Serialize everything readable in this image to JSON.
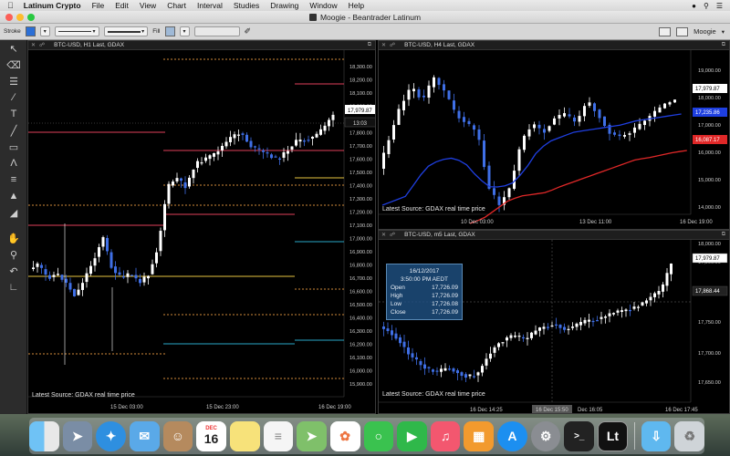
{
  "menubar": {
    "app": "Latinum Crypto",
    "items": [
      "File",
      "Edit",
      "View",
      "Chart",
      "Interval",
      "Studies",
      "Drawing",
      "Window",
      "Help"
    ]
  },
  "window": {
    "title": "Moogie - Beantrader Latinum"
  },
  "toolbar": {
    "stroke_label": "Stroke",
    "fill_label": "Fill",
    "profile": "Moogie"
  },
  "colors": {
    "candle_up": "#ffffff",
    "candle_down": "#3f6fe6",
    "level_red": "#e0405a",
    "level_orange": "#d08a3a",
    "level_yellow": "#e6c341",
    "level_cyan": "#2aa7c9",
    "ma_blue": "#1f3fe0",
    "ma_red": "#e02828"
  },
  "panes": [
    {
      "id": "h1",
      "title": "BTC-USD, H1 Last, GDAX",
      "source": "Latest Source: GDAX real time price",
      "axis_labels": [
        "18,300.00",
        "18,200.00",
        "18,100.00",
        "18,000.00",
        "17,900.00",
        "17,800.00",
        "17,700.00",
        "17,600.00",
        "17,500.00",
        "17,400.00",
        "17,300.00",
        "17,200.00",
        "17,100.00",
        "17,000.00",
        "16,900.00",
        "16,800.00",
        "16,700.00",
        "16,600.00",
        "16,500.00",
        "16,400.00",
        "16,300.00",
        "16,200.00",
        "16,100.00",
        "16,000.00",
        "15,900.00"
      ],
      "time_labels": [
        "15 Dec 03:00",
        "15 Dec 23:00",
        "16 Dec 19:00"
      ],
      "price_tag": "17,979.87",
      "countdown": "13:03"
    },
    {
      "id": "h4",
      "title": "BTC-USD, H4 Last, GDAX",
      "source": "Latest Source: GDAX real time price",
      "axis_labels": [
        "19,000.00",
        "18,000.00",
        "17,000.00",
        "16,000.00",
        "15,000.00",
        "14,000.00"
      ],
      "time_labels": [
        "10 Dec 03:00",
        "13 Dec 11:00",
        "16 Dec 19:00"
      ],
      "price_tags": [
        "17,979.87",
        "17,235.86",
        "16,087.17"
      ]
    },
    {
      "id": "m5",
      "title": "BTC-USD, m5 Last, GDAX",
      "source": "Latest Source: GDAX real time price",
      "axis_labels": [
        "18,000.00",
        "17,900.00",
        "17,800.00",
        "17,750.00",
        "17,700.00",
        "17,650.00"
      ],
      "time_labels": [
        "16 Dec 14:25",
        "16 Dec 15:50",
        "Dec 16:05",
        "16 Dec 17:45"
      ],
      "price_tags": [
        "17,979.87",
        "17,868.44"
      ],
      "tooltip": {
        "date": "16/12/2017",
        "time": "3:50:00 PM AEDT",
        "rows": [
          {
            "label": "Open",
            "value": "17,726.09"
          },
          {
            "label": "High",
            "value": "17,726.09"
          },
          {
            "label": "Low",
            "value": "17,726.08"
          },
          {
            "label": "Close",
            "value": "17,726.09"
          }
        ]
      }
    }
  ],
  "dock": {
    "calendar_month": "DEC",
    "calendar_day": "16",
    "app_badge": "Lt",
    "icons": [
      "finder-icon",
      "launchpad-icon",
      "safari-icon",
      "mail-icon",
      "contacts-icon",
      "calendar-icon",
      "notes-icon",
      "reminders-icon",
      "maps-icon",
      "photos-icon",
      "messages-icon",
      "facetime-icon",
      "music-icon",
      "books-icon",
      "appstore-icon",
      "system-preferences-icon",
      "terminal-icon",
      "latinum-icon",
      "downloads-icon",
      "trash-icon"
    ]
  }
}
